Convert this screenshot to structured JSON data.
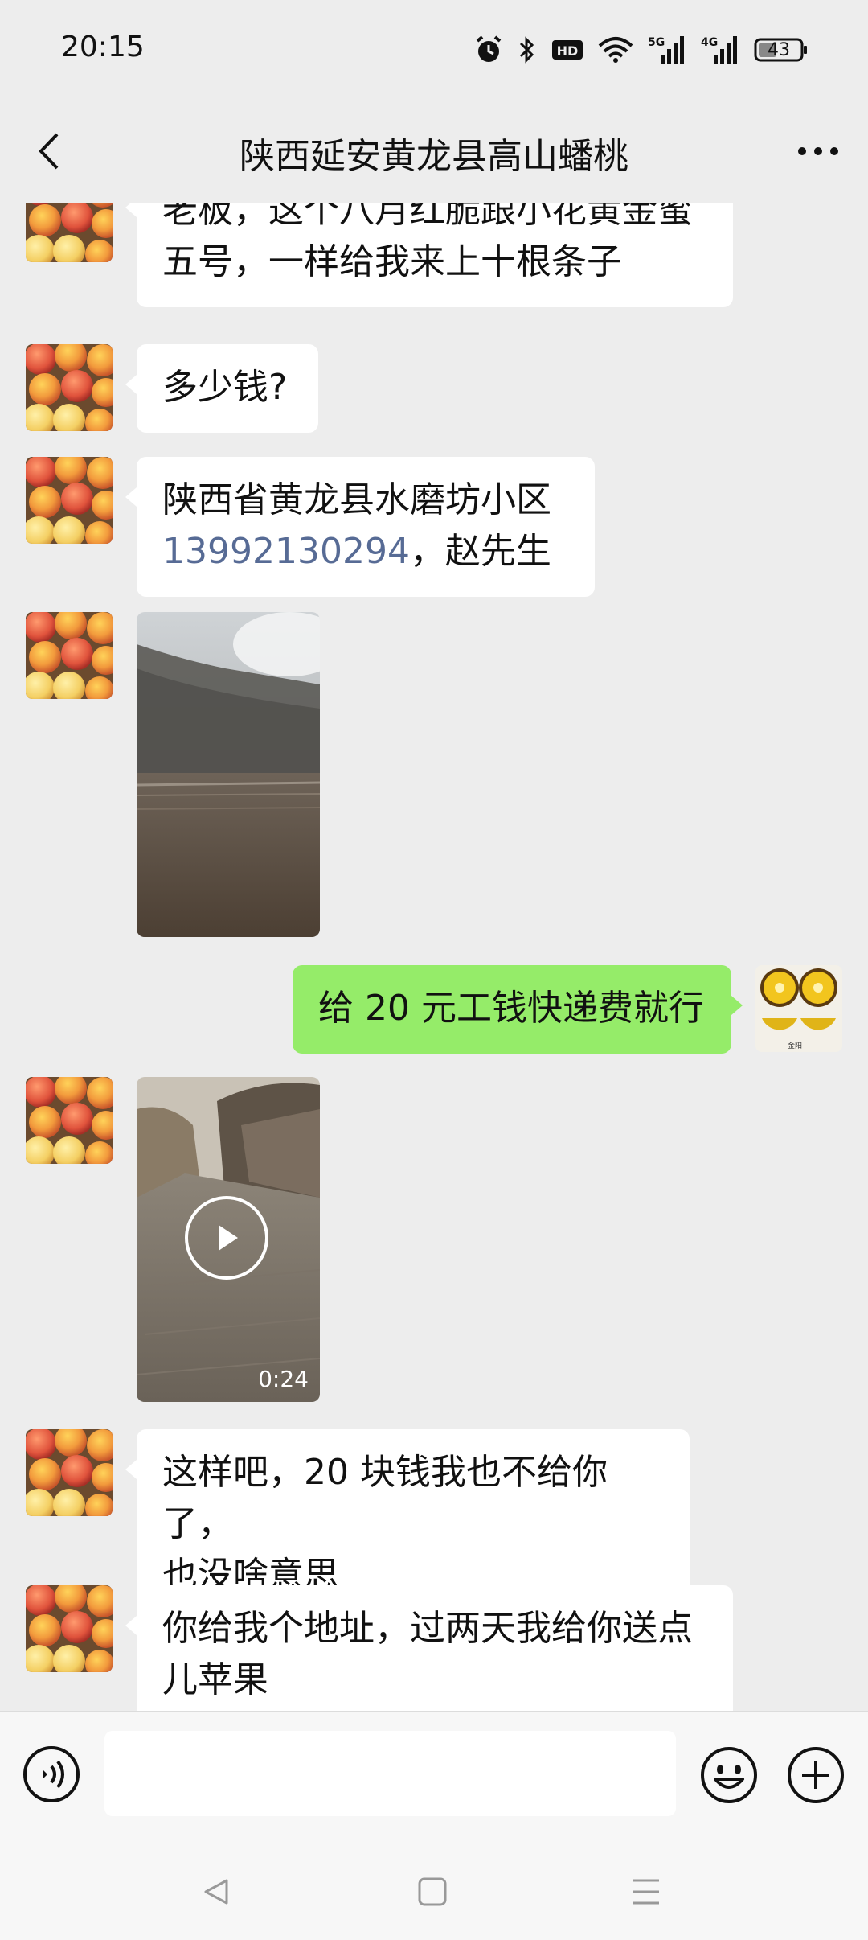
{
  "status_bar": {
    "time": "20:15",
    "network_hd": "HD",
    "network_5g": "5G",
    "network_4g": "4G",
    "battery": "43"
  },
  "header": {
    "title": "陕西延安黄龙县高山蟠桃"
  },
  "messages": [
    {
      "sender": "other",
      "type": "text",
      "lines": [
        "老板，这个八月红脆跟小花黄金蜜",
        "五号，一样给我来上十根条子"
      ]
    },
    {
      "sender": "other",
      "type": "text",
      "lines": [
        "多少钱?"
      ]
    },
    {
      "sender": "other",
      "type": "text",
      "line1": "陕西省黄龙县水磨坊小区",
      "phone": "13992130294",
      "suffix": "，赵先生"
    },
    {
      "sender": "other",
      "type": "image"
    },
    {
      "sender": "self",
      "type": "text",
      "lines": [
        "给 20 元工钱快递费就行"
      ]
    },
    {
      "sender": "other",
      "type": "video",
      "duration": "0:24"
    },
    {
      "sender": "other",
      "type": "text",
      "lines": [
        "这样吧，20 块钱我也不给你了，",
        "也没啥意思"
      ]
    },
    {
      "sender": "other",
      "type": "text",
      "lines": [
        "你给我个地址，过两天我给你送点",
        "儿苹果"
      ]
    }
  ],
  "self_avatar_text": "金阳",
  "icons": {
    "back": "back-arrow-icon",
    "more": "more-dots-icon",
    "voice": "voice-icon",
    "emoji": "emoji-icon",
    "plus": "plus-icon",
    "play": "play-icon"
  },
  "colors": {
    "background": "#ededed",
    "self_bubble": "#95ec69",
    "other_bubble": "#ffffff",
    "phone_link": "#576b95"
  }
}
